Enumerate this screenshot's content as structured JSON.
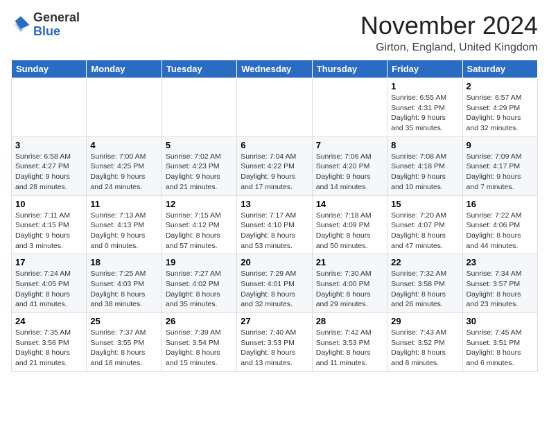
{
  "header": {
    "logo_general": "General",
    "logo_blue": "Blue",
    "month_title": "November 2024",
    "location": "Girton, England, United Kingdom"
  },
  "weekdays": [
    "Sunday",
    "Monday",
    "Tuesday",
    "Wednesday",
    "Thursday",
    "Friday",
    "Saturday"
  ],
  "weeks": [
    [
      {
        "day": "",
        "info": ""
      },
      {
        "day": "",
        "info": ""
      },
      {
        "day": "",
        "info": ""
      },
      {
        "day": "",
        "info": ""
      },
      {
        "day": "",
        "info": ""
      },
      {
        "day": "1",
        "info": "Sunrise: 6:55 AM\nSunset: 4:31 PM\nDaylight: 9 hours and 35 minutes."
      },
      {
        "day": "2",
        "info": "Sunrise: 6:57 AM\nSunset: 4:29 PM\nDaylight: 9 hours and 32 minutes."
      }
    ],
    [
      {
        "day": "3",
        "info": "Sunrise: 6:58 AM\nSunset: 4:27 PM\nDaylight: 9 hours and 28 minutes."
      },
      {
        "day": "4",
        "info": "Sunrise: 7:00 AM\nSunset: 4:25 PM\nDaylight: 9 hours and 24 minutes."
      },
      {
        "day": "5",
        "info": "Sunrise: 7:02 AM\nSunset: 4:23 PM\nDaylight: 9 hours and 21 minutes."
      },
      {
        "day": "6",
        "info": "Sunrise: 7:04 AM\nSunset: 4:22 PM\nDaylight: 9 hours and 17 minutes."
      },
      {
        "day": "7",
        "info": "Sunrise: 7:06 AM\nSunset: 4:20 PM\nDaylight: 9 hours and 14 minutes."
      },
      {
        "day": "8",
        "info": "Sunrise: 7:08 AM\nSunset: 4:18 PM\nDaylight: 9 hours and 10 minutes."
      },
      {
        "day": "9",
        "info": "Sunrise: 7:09 AM\nSunset: 4:17 PM\nDaylight: 9 hours and 7 minutes."
      }
    ],
    [
      {
        "day": "10",
        "info": "Sunrise: 7:11 AM\nSunset: 4:15 PM\nDaylight: 9 hours and 3 minutes."
      },
      {
        "day": "11",
        "info": "Sunrise: 7:13 AM\nSunset: 4:13 PM\nDaylight: 9 hours and 0 minutes."
      },
      {
        "day": "12",
        "info": "Sunrise: 7:15 AM\nSunset: 4:12 PM\nDaylight: 8 hours and 57 minutes."
      },
      {
        "day": "13",
        "info": "Sunrise: 7:17 AM\nSunset: 4:10 PM\nDaylight: 8 hours and 53 minutes."
      },
      {
        "day": "14",
        "info": "Sunrise: 7:18 AM\nSunset: 4:09 PM\nDaylight: 8 hours and 50 minutes."
      },
      {
        "day": "15",
        "info": "Sunrise: 7:20 AM\nSunset: 4:07 PM\nDaylight: 8 hours and 47 minutes."
      },
      {
        "day": "16",
        "info": "Sunrise: 7:22 AM\nSunset: 4:06 PM\nDaylight: 8 hours and 44 minutes."
      }
    ],
    [
      {
        "day": "17",
        "info": "Sunrise: 7:24 AM\nSunset: 4:05 PM\nDaylight: 8 hours and 41 minutes."
      },
      {
        "day": "18",
        "info": "Sunrise: 7:25 AM\nSunset: 4:03 PM\nDaylight: 8 hours and 38 minutes."
      },
      {
        "day": "19",
        "info": "Sunrise: 7:27 AM\nSunset: 4:02 PM\nDaylight: 8 hours and 35 minutes."
      },
      {
        "day": "20",
        "info": "Sunrise: 7:29 AM\nSunset: 4:01 PM\nDaylight: 8 hours and 32 minutes."
      },
      {
        "day": "21",
        "info": "Sunrise: 7:30 AM\nSunset: 4:00 PM\nDaylight: 8 hours and 29 minutes."
      },
      {
        "day": "22",
        "info": "Sunrise: 7:32 AM\nSunset: 3:58 PM\nDaylight: 8 hours and 26 minutes."
      },
      {
        "day": "23",
        "info": "Sunrise: 7:34 AM\nSunset: 3:57 PM\nDaylight: 8 hours and 23 minutes."
      }
    ],
    [
      {
        "day": "24",
        "info": "Sunrise: 7:35 AM\nSunset: 3:56 PM\nDaylight: 8 hours and 21 minutes."
      },
      {
        "day": "25",
        "info": "Sunrise: 7:37 AM\nSunset: 3:55 PM\nDaylight: 8 hours and 18 minutes."
      },
      {
        "day": "26",
        "info": "Sunrise: 7:39 AM\nSunset: 3:54 PM\nDaylight: 8 hours and 15 minutes."
      },
      {
        "day": "27",
        "info": "Sunrise: 7:40 AM\nSunset: 3:53 PM\nDaylight: 8 hours and 13 minutes."
      },
      {
        "day": "28",
        "info": "Sunrise: 7:42 AM\nSunset: 3:53 PM\nDaylight: 8 hours and 11 minutes."
      },
      {
        "day": "29",
        "info": "Sunrise: 7:43 AM\nSunset: 3:52 PM\nDaylight: 8 hours and 8 minutes."
      },
      {
        "day": "30",
        "info": "Sunrise: 7:45 AM\nSunset: 3:51 PM\nDaylight: 8 hours and 6 minutes."
      }
    ]
  ]
}
